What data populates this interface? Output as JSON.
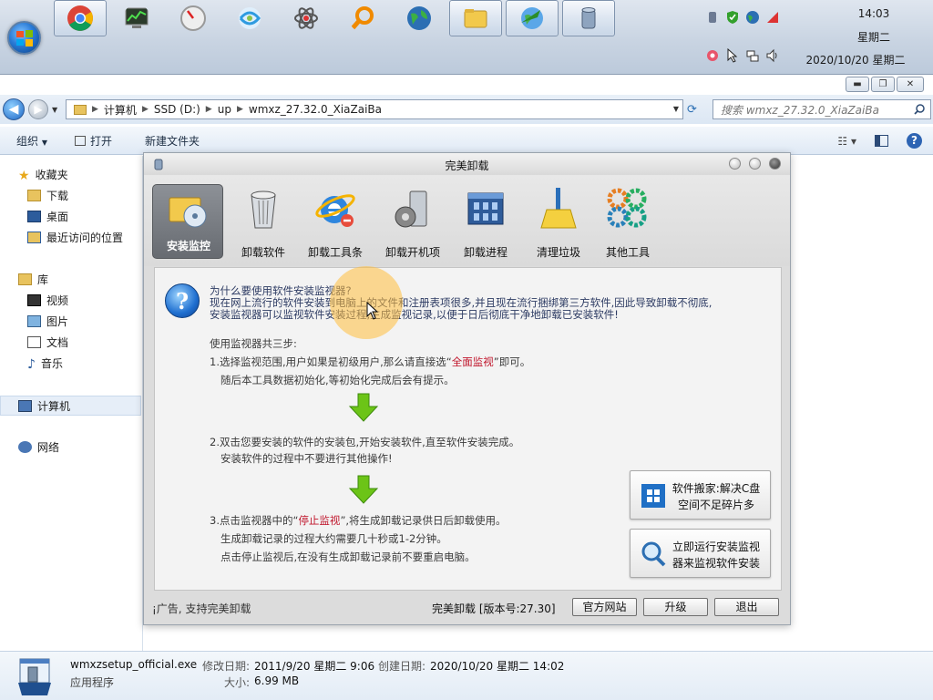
{
  "taskbar": {
    "clock_time": "14:03",
    "clock_day": "星期二",
    "clock_date": "2020/10/20 星期二"
  },
  "explorer": {
    "breadcrumbs": [
      "计算机",
      "SSD (D:)",
      "up",
      "wmxz_27.32.0_XiaZaiBa"
    ],
    "search_placeholder": "搜索 wmxz_27.32.0_XiaZaiBa",
    "toolbar": {
      "organize": "组织",
      "open": "打开",
      "new_folder": "新建文件夹"
    },
    "nav": {
      "favorites": "收藏夹",
      "downloads": "下载",
      "desktop": "桌面",
      "recent": "最近访问的位置",
      "libraries": "库",
      "videos": "视频",
      "pictures": "图片",
      "documents": "文档",
      "music": "音乐",
      "computer": "计算机",
      "network": "网络"
    },
    "details": {
      "filename": "wmxzsetup_official.exe",
      "type": "应用程序",
      "modified_label": "修改日期:",
      "modified_value": "2011/9/20 星期二 9:06",
      "created_label": "创建日期:",
      "created_value": "2020/10/20 星期二 14:02",
      "size_label": "大小:",
      "size_value": "6.99 MB"
    }
  },
  "dialog": {
    "title": "完美卸载",
    "tabs": [
      "安装监控",
      "卸载软件",
      "卸载工具条",
      "卸载开机项",
      "卸载进程",
      "清理垃圾",
      "其他工具"
    ],
    "question_title": "为什么要使用软件安装监视器?",
    "intro_line1": "现在网上流行的软件安装到电脑上的文件和注册表项很多,并且现在流行捆绑第三方软件,因此导致卸载不彻底,",
    "intro_line2": "安装监视器可以监视软件安装过程,生成监视记录,以便于日后彻底干净地卸载已安装软件!",
    "steps_title": "使用监视器共三步:",
    "step1_prefix": "1.选择监视范围,用户如果是初级用户,那么请直接选“",
    "step1_highlight": "全面监视",
    "step1_suffix": "”即可。",
    "step1_line2": "随后本工具数据初始化,等初始化完成后会有提示。",
    "step2_line1": "2.双击您要安装的软件的安装包,开始安装软件,直至软件安装完成。",
    "step2_line2": "安装软件的过程中不要进行其他操作!",
    "step3_prefix": "3.点击监视器中的“",
    "step3_highlight": "停止监视",
    "step3_suffix": "”,将生成卸载记录供日后卸载使用。",
    "step3_line2": "生成卸载记录的过程大约需要几十秒或1-2分钟。",
    "step3_line3": "点击停止监视后,在没有生成卸载记录前不要重启电脑。",
    "side_btn1_line1": "软件搬家:解决C盘",
    "side_btn1_line2": "空间不足碎片多",
    "side_btn2_line1": "立即运行安装监视",
    "side_btn2_line2": "器来监视软件安装",
    "footer_left": "¡广告, 支持完美卸载",
    "version": "完美卸载 [版本号:27.30]",
    "btn_official": "官方网站",
    "btn_upgrade": "升级",
    "btn_exit": "退出"
  },
  "colors": {
    "highlight_red": "#c0152b",
    "arrow_green": "#6cc417"
  }
}
